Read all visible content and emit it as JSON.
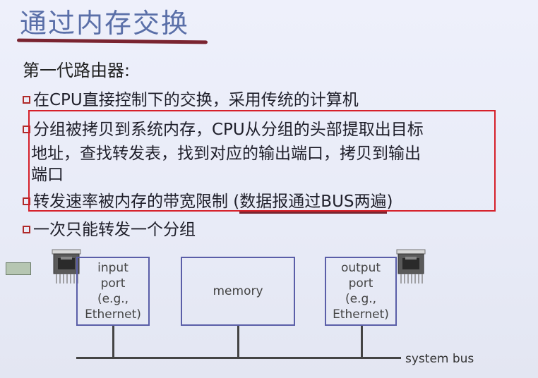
{
  "title": "通过内存交换",
  "subtitle": "第一代路由器:",
  "bullets": {
    "b1": "在CPU直接控制下的交换，采用传统的计算机",
    "b2_line1": "分组被拷贝到系统内存，CPU从分组的头部提取出目标",
    "b2_line2": "地址，查找转发表，找到对应的输出端口，拷贝到输出",
    "b2_line3": "端口",
    "b3_prefix": "转发速率被内存的带宽限制 (",
    "b3_underlined": "数据报通过BUS两遍",
    "b3_suffix": ")",
    "b4": "一次只能转发一个分组"
  },
  "diagram": {
    "input_port_line1": "input",
    "input_port_line2": "port",
    "input_port_line3": "(e.g.,",
    "input_port_line4": "Ethernet)",
    "memory": "memory",
    "output_port_line1": "output",
    "output_port_line2": "port",
    "output_port_line3": "(e.g.,",
    "output_port_line4": "Ethernet)",
    "system_bus": "system bus"
  },
  "colors": {
    "title": "#5a6fa8",
    "highlight_border": "#d6202a",
    "diagram_border": "#5a5ea8"
  },
  "icons": {
    "left_connector": "ethernet-port-icon",
    "right_connector": "ethernet-port-icon"
  }
}
